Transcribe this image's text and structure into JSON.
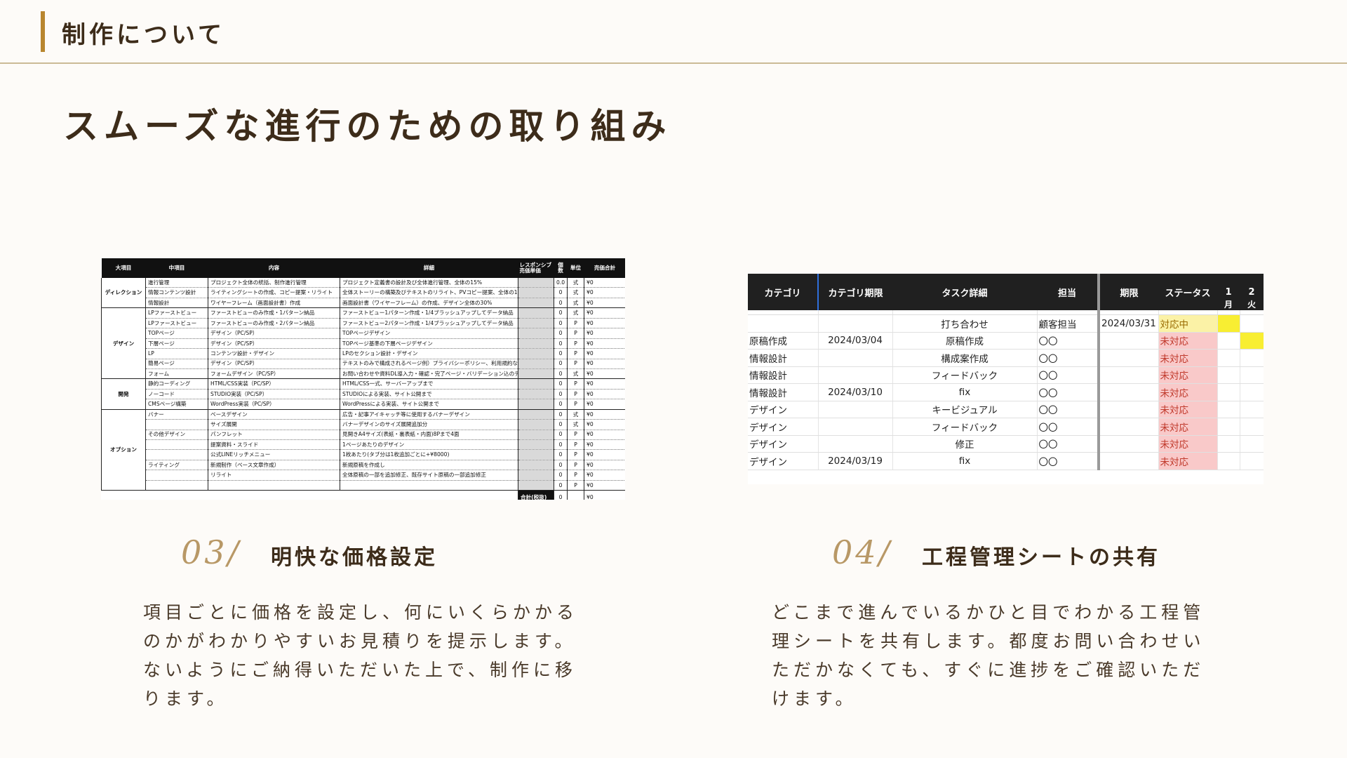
{
  "header": {
    "title": "制作について"
  },
  "main_title": "スムーズな進行のための取り組み",
  "price_table": {
    "headers": [
      "大項目",
      "中項目",
      "内容",
      "詳細",
      "レスポンシブ\n売価単価",
      "個数",
      "単位",
      "売価合計"
    ],
    "categories": [
      "ディレクション",
      "デザイン",
      "開発",
      "オプション"
    ],
    "rows": [
      [
        "進行管理",
        "プロジェクト全体の統括、制作進行管理",
        "プロジェクト定義書の設計及び全体進行管理、全体の15%",
        "0.0",
        "式",
        "¥0"
      ],
      [
        "情報コンテンツ設計",
        "ライティングシートの作成、コピー提案・リライト",
        "全体ストーリーの構築及びテキストのリライト、PVコピー提案、全体の10%",
        "0",
        "式",
        "¥0"
      ],
      [
        "情報設計",
        "ワイヤーフレーム（画面設計書）作成",
        "画面設計書（ワイヤーフレーム）の作成、デザイン全体の30%",
        "0",
        "式",
        "¥0"
      ],
      [
        "LPファーストビュー",
        "ファーストビューのみ作成・1パターン納品",
        "ファーストビュー1パターン作成・1/4ブラッシュアップしてデータ納品",
        "0",
        "式",
        "¥0"
      ],
      [
        "LPファーストビュー",
        "ファーストビューのみ作成・2パターン納品",
        "ファーストビュー2パターン作成・1/4ブラッシュアップしてデータ納品",
        "0",
        "P",
        "¥0"
      ],
      [
        "TOPページ",
        "デザイン（PC/SP）",
        "TOPページデザイン",
        "0",
        "P",
        "¥0"
      ],
      [
        "下層ページ",
        "デザイン（PC/SP）",
        "TOPページ基準の下層ページデザイン",
        "0",
        "P",
        "¥0"
      ],
      [
        "LP",
        "コンテンツ設計・デザイン",
        "LPのセクション設計・デザイン",
        "0",
        "P",
        "¥0"
      ],
      [
        "簡易ページ",
        "デザイン（PC/SP）",
        "テキストのみで構成されるページ例）プライバシーポリシー、利用規約など",
        "0",
        "P",
        "¥0"
      ],
      [
        "フォーム",
        "フォームデザイン（PC/SP）",
        "お問い合わせや資料DL導入力・確認・完了ページ・バリデーション込のデザイン",
        "0",
        "式",
        "¥0"
      ],
      [
        "静的コーディング",
        "HTML/CSS実装（PC/SP）",
        "HTML/CSS一式、サーバーアップまで",
        "0",
        "P",
        "¥0"
      ],
      [
        "ノーコード",
        "STUDIO実装（PC/SP）",
        "STUDIOによる実装、サイト公開まで",
        "0",
        "P",
        "¥0"
      ],
      [
        "CMSページ構築",
        "WordPress実装（PC/SP）",
        "WordPressによる実装、サイト公開まで",
        "0",
        "P",
        "¥0"
      ],
      [
        "バナー",
        "ベースデザイン",
        "広告・記事アイキャッチ等に使用するバナーデザイン",
        "0",
        "式",
        "¥0"
      ],
      [
        "",
        "サイズ展開",
        "バナーデザインのサイズ展開追加分",
        "0",
        "式",
        "¥0"
      ],
      [
        "その他デザイン",
        "パンフレット",
        "見開きA4サイズ(表紙・裏表紙・内面)8Pまで4面",
        "0",
        "P",
        "¥0"
      ],
      [
        "",
        "提案資料・スライド",
        "1ページあたりのデザイン",
        "0",
        "P",
        "¥0"
      ],
      [
        "",
        "公式LINEリッチメニュー",
        "1枚あたり(タブ分は1枚追加ごとに+¥8000)",
        "0",
        "P",
        "¥0"
      ],
      [
        "ライティング",
        "新規制作（ベース文章作成）",
        "新規原稿を作成し",
        "0",
        "P",
        "¥0"
      ],
      [
        "",
        "リライト",
        "全体原稿の一部を追加修正、既存サイト原稿の一部追加修正",
        "0",
        "P",
        "¥0"
      ],
      [
        "",
        "",
        "",
        "0",
        "P",
        "¥0"
      ]
    ],
    "total": {
      "label": "合計(税抜)",
      "qty": "0",
      "amount": "¥0"
    }
  },
  "schedule_sheet": {
    "headers": [
      "カテゴリ",
      "カテゴリ期限",
      "タスク詳細",
      "担当",
      "期限",
      "ステータス",
      "1",
      "2"
    ],
    "weekdays": [
      "月",
      "火"
    ],
    "rows": [
      [
        "",
        "",
        "打ち合わせ",
        "顧客担当",
        "2024/03/31",
        "対応中"
      ],
      [
        "原稿作成",
        "2024/03/04",
        "原稿作成",
        "〇〇",
        "",
        "未対応"
      ],
      [
        "情報設計",
        "",
        "構成案作成",
        "〇〇",
        "",
        "未対応"
      ],
      [
        "情報設計",
        "",
        "フィードバック",
        "〇〇",
        "",
        "未対応"
      ],
      [
        "情報設計",
        "2024/03/10",
        "fix",
        "〇〇",
        "",
        "未対応"
      ],
      [
        "デザイン",
        "",
        "キービジュアル",
        "〇〇",
        "",
        "未対応"
      ],
      [
        "デザイン",
        "",
        "フィードバック",
        "〇〇",
        "",
        "未対応"
      ],
      [
        "デザイン",
        "",
        "修正",
        "〇〇",
        "",
        "未対応"
      ],
      [
        "デザイン",
        "2024/03/19",
        "fix",
        "〇〇",
        "",
        "未対応"
      ]
    ],
    "colors": {
      "pending": "#f9c9c9",
      "in_progress": "#fbf2a6",
      "highlight": "#f8ee32"
    }
  },
  "sections": [
    {
      "number": "03/",
      "title": "明快な価格設定",
      "body": "項目ごとに価格を設定し、何にいくらかかるのかがわかりやすいお見積りを提示します。ないようにご納得いただいた上で、制作に移ります。"
    },
    {
      "number": "04/",
      "title": "工程管理シートの共有",
      "body": "どこまで進んでいるかひと目でわかる工程管理シートを共有します。都度お問い合わせいただかなくても、すぐに進捗をご確認いただけます。"
    }
  ],
  "colors": {
    "accent": "#b8862f",
    "text": "#3d2c1a",
    "background": "#fdfbf8",
    "number": "#b89866"
  }
}
